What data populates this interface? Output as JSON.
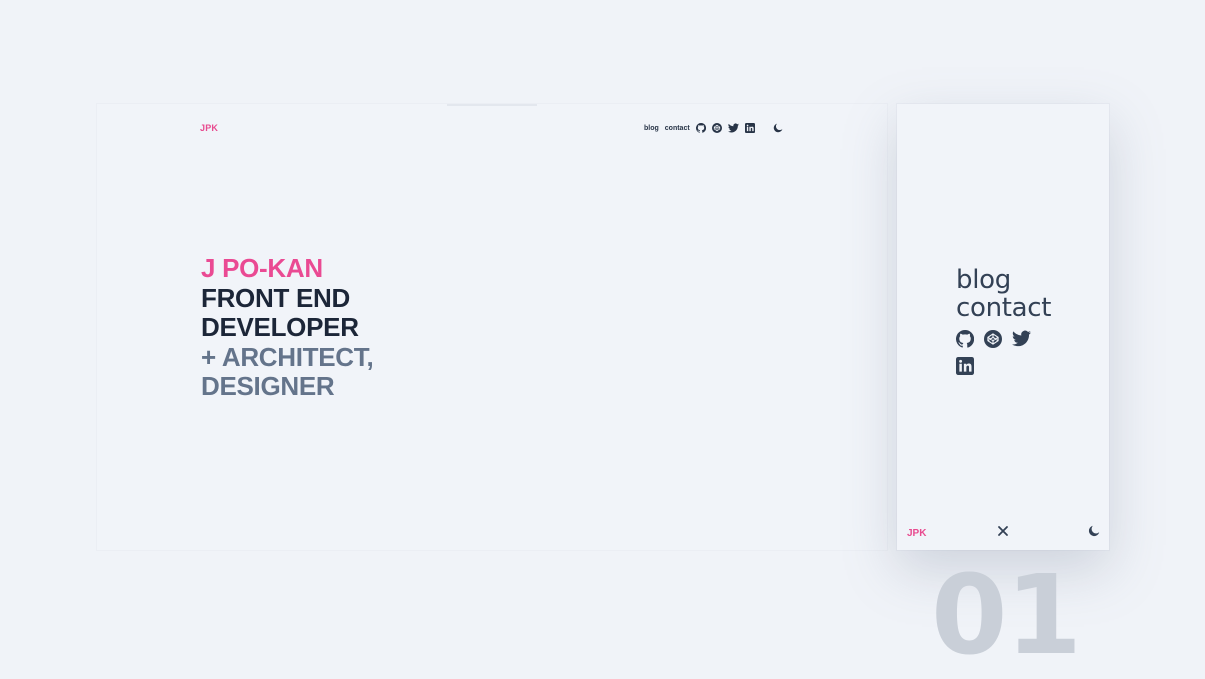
{
  "brand": "JPK",
  "nav": {
    "blog": "blog",
    "contact": "contact"
  },
  "social_icons": [
    "github-icon",
    "codepen-icon",
    "twitter-icon",
    "linkedin-icon"
  ],
  "hero": {
    "name": "J PO-KAN",
    "title_line1": "FRONT END",
    "title_line2": "DEVELOPER",
    "sub_line1": "+ ARCHITECT,",
    "sub_line2": "DESIGNER"
  },
  "mobile": {
    "menu": {
      "blog": "blog",
      "contact": "contact"
    },
    "footer_brand": "JPK"
  },
  "page_number": "01",
  "colors": {
    "accent": "#ea4a93",
    "dark": "#1c2638",
    "muted": "#64748b",
    "background": "#f0f3f8"
  }
}
